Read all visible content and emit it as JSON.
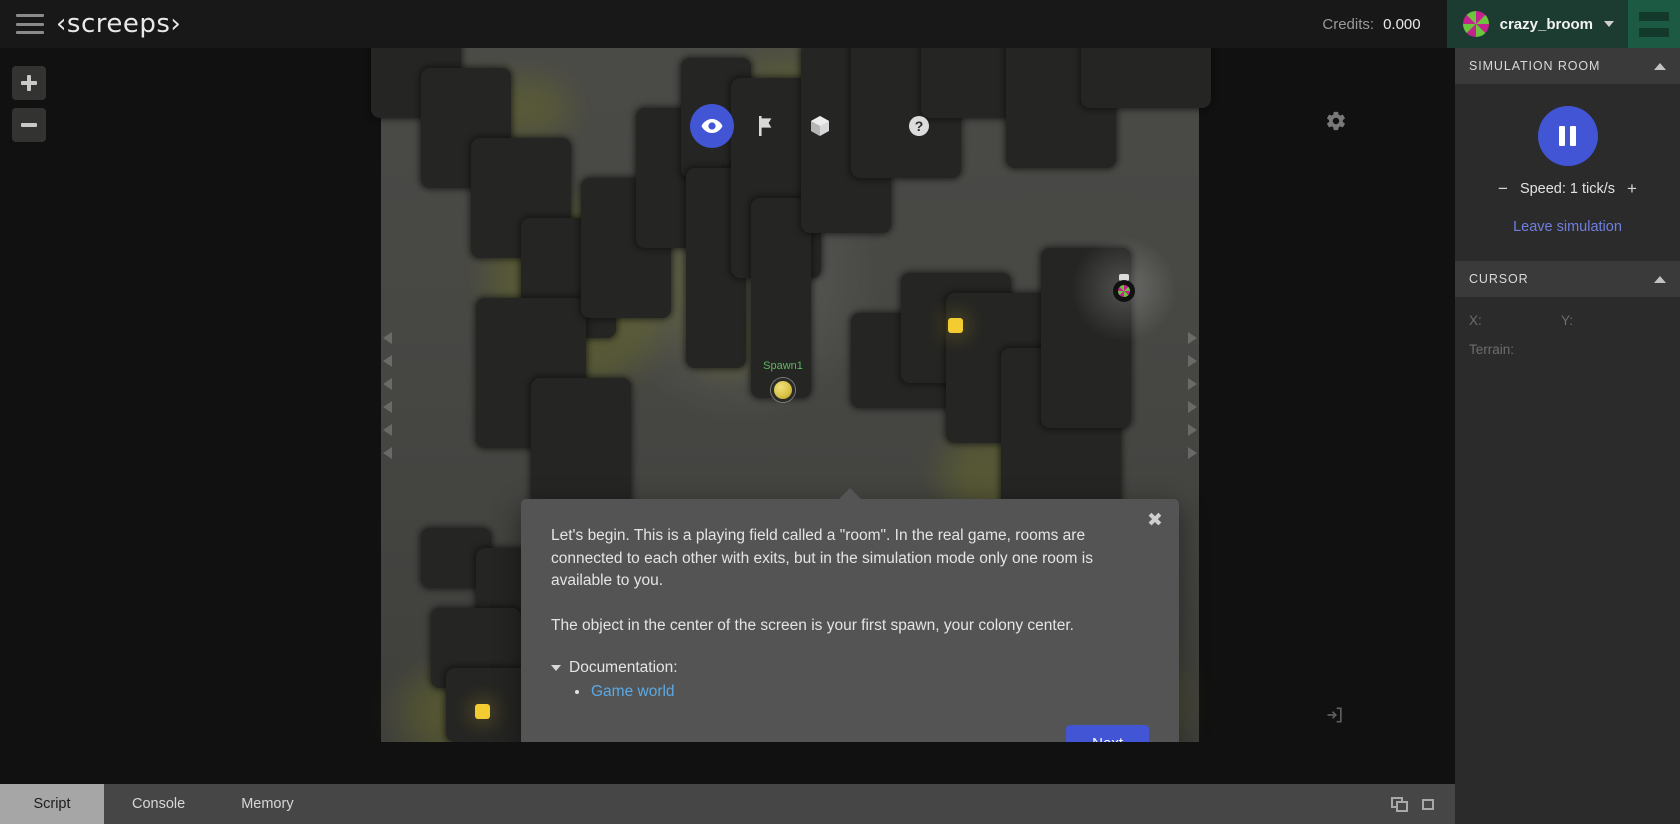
{
  "topbar": {
    "logo_text": "‹screeps›",
    "menu_icon": "hamburger-icon",
    "credits_label": "Credits:",
    "credits_value": "0.000",
    "username": "crazy_broom",
    "right_menu_icon": "hamburger-icon"
  },
  "map": {
    "zoom_in_label": "+",
    "zoom_out_label": "−",
    "tools": [
      {
        "name": "eye-icon",
        "label": "View",
        "active": true
      },
      {
        "name": "flag-icon",
        "label": "Flags",
        "active": false
      },
      {
        "name": "cube-icon",
        "label": "Construct",
        "active": false
      },
      {
        "name": "help-icon",
        "label": "Help",
        "active": false
      }
    ],
    "settings_icon": "gear-icon",
    "enter_icon": "enter-room-icon",
    "spawn_label": "Spawn1"
  },
  "dialog": {
    "close_label": "✖",
    "paragraph_1": "Let's begin. This is a playing field called a \"room\". In the real game, rooms are connected to each other with exits, but in the simulation mode only one room is available to you.",
    "paragraph_2": "The object in the center of the screen is your first spawn, your colony center.",
    "documentation_label": "Documentation:",
    "documentation_links": [
      "Game world"
    ],
    "next_label": "Next"
  },
  "sidebar": {
    "simulation": {
      "title": "SIMULATION ROOM",
      "pause_icon": "pause-icon",
      "speed_minus": "−",
      "speed_label": "Speed: 1 tick/s",
      "speed_plus": "+",
      "leave_label": "Leave simulation"
    },
    "cursor": {
      "title": "CURSOR",
      "x_label": "X:",
      "x_value": "",
      "y_label": "Y:",
      "y_value": "",
      "terrain_label": "Terrain:",
      "terrain_value": ""
    }
  },
  "bottom": {
    "tabs": [
      {
        "label": "Script",
        "active": true
      },
      {
        "label": "Console",
        "active": false
      },
      {
        "label": "Memory",
        "active": false
      }
    ],
    "window_icons": [
      "popout-window-icon",
      "single-window-icon"
    ]
  },
  "colors": {
    "accent_blue": "#4255d4",
    "link_blue": "#5aa9e6",
    "leave_link": "#6f7fe0",
    "header_green": "#1d3c31",
    "spawn_name_green": "#5fb760",
    "source_yellow": "#f2cc30",
    "dialog_bg": "#545454",
    "sidebar_bg": "#2b2b2b"
  }
}
